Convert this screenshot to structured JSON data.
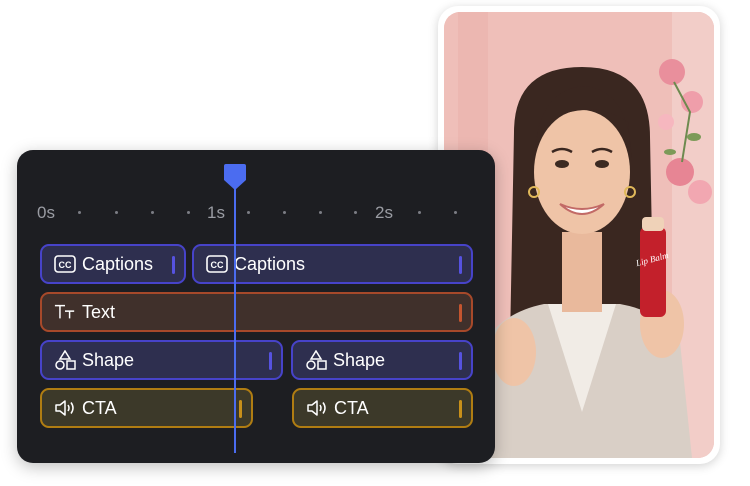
{
  "timeline": {
    "ruler_labels": [
      "0s",
      "1s",
      "2s"
    ],
    "tracks": [
      {
        "name": "captions",
        "clips": [
          {
            "label": "Captions",
            "icon": "closed-captions-icon"
          },
          {
            "label": "Captions",
            "icon": "closed-captions-icon"
          }
        ]
      },
      {
        "name": "text",
        "clips": [
          {
            "label": "Text",
            "icon": "text-icon"
          }
        ]
      },
      {
        "name": "shape",
        "clips": [
          {
            "label": "Shape",
            "icon": "shapes-icon"
          },
          {
            "label": "Shape",
            "icon": "shapes-icon"
          }
        ]
      },
      {
        "name": "cta",
        "clips": [
          {
            "label": "CTA",
            "icon": "speaker-icon"
          },
          {
            "label": "CTA",
            "icon": "speaker-icon"
          }
        ]
      }
    ]
  },
  "preview": {
    "product_label": "Lip Balm"
  },
  "colors": {
    "panel_bg": "#1d1e22",
    "playhead": "#4b6cf0",
    "captions_border": "#4743c9",
    "text_border": "#a7492a",
    "cta_border": "#b07d12"
  }
}
